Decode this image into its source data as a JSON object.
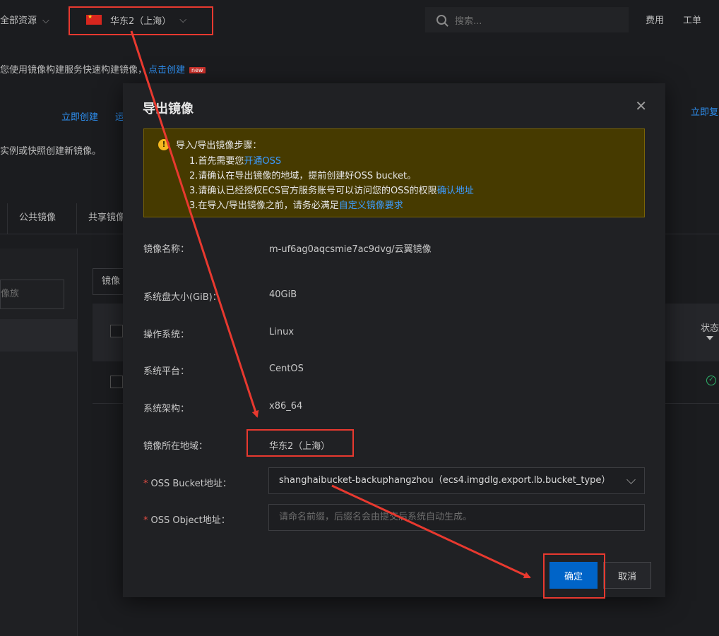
{
  "topbar": {
    "resources_label": "全部资源",
    "region_label": "华东2（上海）",
    "search_placeholder": "搜索...",
    "fee_label": "费用",
    "ticket_label": "工单"
  },
  "background": {
    "tip_text": "您使用镜像构建服务快速构建镜像，",
    "tip_link": "点击创建",
    "new_badge": "new",
    "create_now_1": "立即创建",
    "create_now_1b": "运",
    "create_now_2": "立即复",
    "desc_text": "实例或快照创建新镜像。",
    "tab_public": "公共镜像",
    "tab_shared": "共享镜像",
    "side_placeholder": "像族",
    "table_filter": "镜像",
    "status_header": "状态"
  },
  "modal": {
    "title": "导出镜像",
    "notice": {
      "title": "导入/导出镜像步骤：",
      "line1_prefix": "1.首先需要您",
      "line1_link": "开通OSS",
      "line2": "2.请确认在导出镜像的地域，提前创建好OSS bucket。",
      "line3_prefix": "3.请确认已经授权ECS官方服务账号可以访问您的OSS的权限",
      "line3_link": "确认地址",
      "line4_prefix": "3.在导入/导出镜像之前，请务必满足",
      "line4_link": "自定义镜像要求"
    },
    "fields": {
      "image_name_label": "镜像名称：",
      "image_name_value": "m-uf6ag0aqcsmie7ac9dvg/云翼镜像",
      "disk_size_label": "系统盘大小(GiB)：",
      "disk_size_value": "40GiB",
      "os_label": "操作系统：",
      "os_value": "Linux",
      "platform_label": "系统平台：",
      "platform_value": "CentOS",
      "arch_label": "系统架构：",
      "arch_value": "x86_64",
      "region_label": "镜像所在地域：",
      "region_value": "华东2（上海）",
      "bucket_label": "OSS Bucket地址：",
      "bucket_value": "shanghaibucket-backuphangzhou（ecs4.imgdlg.export.lb.bucket_type）",
      "object_label": "OSS Object地址：",
      "object_placeholder": "请命名前缀，后缀名会由提交后系统自动生成。",
      "required_mark": "*"
    },
    "ok_label": "确定",
    "cancel_label": "取消"
  },
  "colors": {
    "accent": "#0064c8",
    "link": "#2e8ff0",
    "annotation": "#e8392f",
    "notice_bg": "#463a00"
  }
}
